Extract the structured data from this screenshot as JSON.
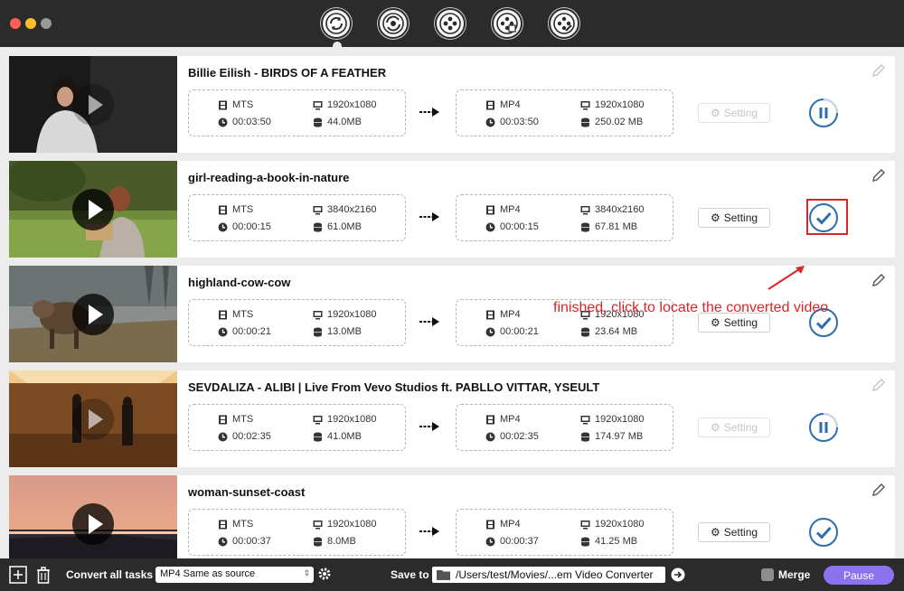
{
  "window": {
    "nav_tabs": [
      {
        "name": "convert-icon",
        "active": true
      },
      {
        "name": "convert-alt-icon",
        "active": false
      },
      {
        "name": "film-edit-icon",
        "active": false
      },
      {
        "name": "film-music-icon",
        "active": false
      },
      {
        "name": "film-tools-icon",
        "active": false
      }
    ]
  },
  "tasks": [
    {
      "title": "Billie Eilish - BIRDS OF A FEATHER",
      "src_format": "MTS",
      "src_res": "1920x1080",
      "src_duration": "00:03:50",
      "src_size": "44.0MB",
      "dst_format": "MP4",
      "dst_res": "1920x1080",
      "dst_duration": "00:03:50",
      "dst_size": "250.02 MB",
      "setting_label": "Setting",
      "status": "converting",
      "setting_enabled": false
    },
    {
      "title": "girl-reading-a-book-in-nature",
      "src_format": "MTS",
      "src_res": "3840x2160",
      "src_duration": "00:00:15",
      "src_size": "61.0MB",
      "dst_format": "MP4",
      "dst_res": "3840x2160",
      "dst_duration": "00:00:15",
      "dst_size": "67.81 MB",
      "setting_label": "Setting",
      "status": "done",
      "setting_enabled": true
    },
    {
      "title": "highland-cow-cow",
      "src_format": "MTS",
      "src_res": "1920x1080",
      "src_duration": "00:00:21",
      "src_size": "13.0MB",
      "dst_format": "MP4",
      "dst_res": "1920x1080",
      "dst_duration": "00:00:21",
      "dst_size": "23.64 MB",
      "setting_label": "Setting",
      "status": "done",
      "setting_enabled": true
    },
    {
      "title": "SEVDALIZA - ALIBI | Live From Vevo Studios ft. PABLLO VITTAR, YSEULT",
      "src_format": "MTS",
      "src_res": "1920x1080",
      "src_duration": "00:02:35",
      "src_size": "41.0MB",
      "dst_format": "MP4",
      "dst_res": "1920x1080",
      "dst_duration": "00:02:35",
      "dst_size": "174.97 MB",
      "setting_label": "Setting",
      "status": "converting",
      "setting_enabled": false
    },
    {
      "title": "woman-sunset-coast",
      "src_format": "MTS",
      "src_res": "1920x1080",
      "src_duration": "00:00:37",
      "src_size": "8.0MB",
      "dst_format": "MP4",
      "dst_res": "1920x1080",
      "dst_duration": "00:00:37",
      "dst_size": "41.25 MB",
      "setting_label": "Setting",
      "status": "done",
      "setting_enabled": true
    }
  ],
  "annotation": {
    "text": "finished, click to locate the converted video",
    "color": "#d8262a"
  },
  "bottom_bar": {
    "convert_all_label": "Convert all tasks to",
    "format_value": "MP4 Same as source",
    "save_to_label": "Save to",
    "save_path": "/Users/test/Movies/...em Video Converter",
    "merge_label": "Merge",
    "merge_checked": false,
    "pause_label": "Pause"
  },
  "colors": {
    "accent": "#8b73f0",
    "status_blue": "#2e6dad",
    "titlebar": "#2b2b2b"
  }
}
